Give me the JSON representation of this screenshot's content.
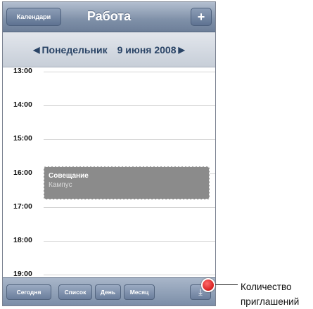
{
  "nav": {
    "back_label": "Календари",
    "title": "Работа",
    "add_label": "+"
  },
  "datebar": {
    "prev_arrow": "◀",
    "day_name": "Понедельник",
    "date": "9 июня 2008",
    "next_arrow": "▶"
  },
  "hours": [
    "13:00",
    "14:00",
    "15:00",
    "16:00",
    "17:00",
    "18:00",
    "19:00"
  ],
  "event": {
    "title": "Совещание",
    "location": "Кампус"
  },
  "tabbar": {
    "today": "Сегодня",
    "list": "Список",
    "day": "День",
    "month": "Месяц",
    "inbox_icon": "inbox-tray-icon"
  },
  "callout": {
    "line1": "Количество",
    "line2": "приглашений"
  },
  "colors": {
    "nav": "#7f90a8",
    "date_text": "#2a4466",
    "event": "#8b8b8b",
    "badge": "#d60000"
  }
}
